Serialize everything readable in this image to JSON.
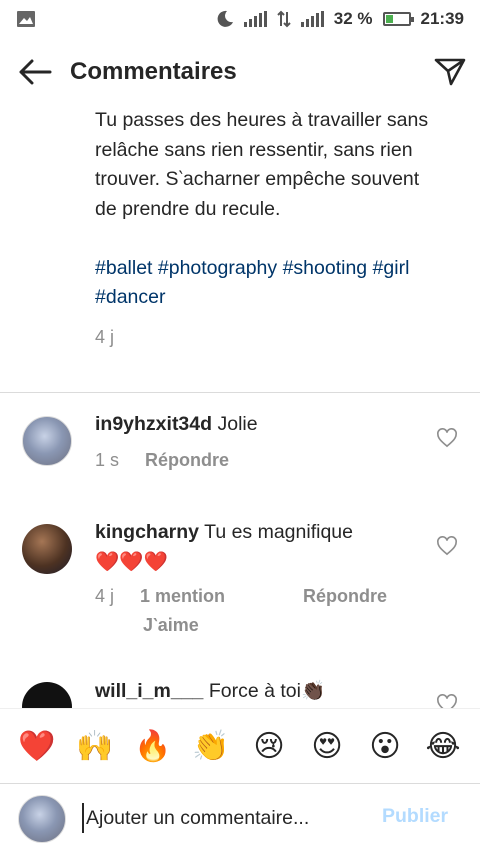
{
  "status_bar": {
    "battery": "32 %",
    "battery_level": 0.32,
    "time": "21:39",
    "icons": [
      "image-icon",
      "moon-icon",
      "signal-icon",
      "data-arrows-icon",
      "hplus-signal-icon",
      "battery-icon"
    ]
  },
  "header": {
    "title": "Commentaires",
    "back_icon": "arrow-left-icon",
    "send_icon": "paper-plane-icon"
  },
  "caption": {
    "text": "Tu passes des heures à travailler sans relâche sans rien ressentir, sans rien trouver. S‵acharner empêche souvent de prendre du recule.",
    "hashtags": "#ballet #photography #shooting #girl  #dancer",
    "age": "4 j"
  },
  "comments": [
    {
      "user": "in9yhzxit34d",
      "text": "Jolie",
      "age": "1 s",
      "reply": "Répondre"
    },
    {
      "user": "kingcharny",
      "text": "Tu es magnifique",
      "emoji": "❤️❤️❤️",
      "age": "4 j",
      "mentions": "1 mention",
      "reply": "Répondre",
      "like": "J‵aime"
    },
    {
      "user": "will_i_m___",
      "text": "Force à toi",
      "emoji": "👏🏿"
    }
  ],
  "emoji_bar": [
    "❤️",
    "🙌",
    "🔥",
    "👏",
    "😢",
    "😍",
    "😮",
    "😂"
  ],
  "composer": {
    "placeholder": "Ajouter un commentaire...",
    "post_label": "Publier"
  },
  "colors": {
    "hashtag": "#003569",
    "meta": "#8e8e8e",
    "post_disabled": "#b3dbff",
    "heart_red": "#ed4956"
  }
}
